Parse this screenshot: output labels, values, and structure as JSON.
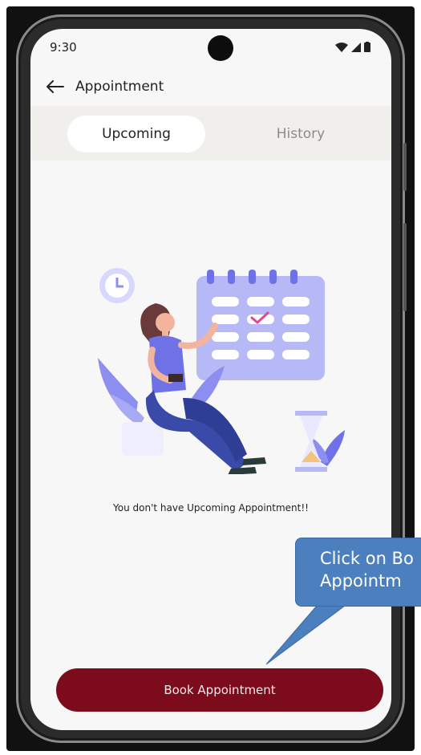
{
  "status_bar": {
    "time": "9:30"
  },
  "header": {
    "title": "Appointment"
  },
  "tabs": [
    {
      "label": "Upcoming",
      "active": true
    },
    {
      "label": "History",
      "active": false
    }
  ],
  "empty_state": {
    "message": "You don't have Upcoming Appointment!!"
  },
  "actions": {
    "book_label": "Book Appointment"
  },
  "annotation": {
    "line1": "Click on Bo",
    "line2": "Appointm"
  },
  "colors": {
    "accent": "#7c0c1c",
    "callout": "#4c7fbe",
    "illustration": "#8d8ff0",
    "screen_bg": "#f7f7f7"
  }
}
